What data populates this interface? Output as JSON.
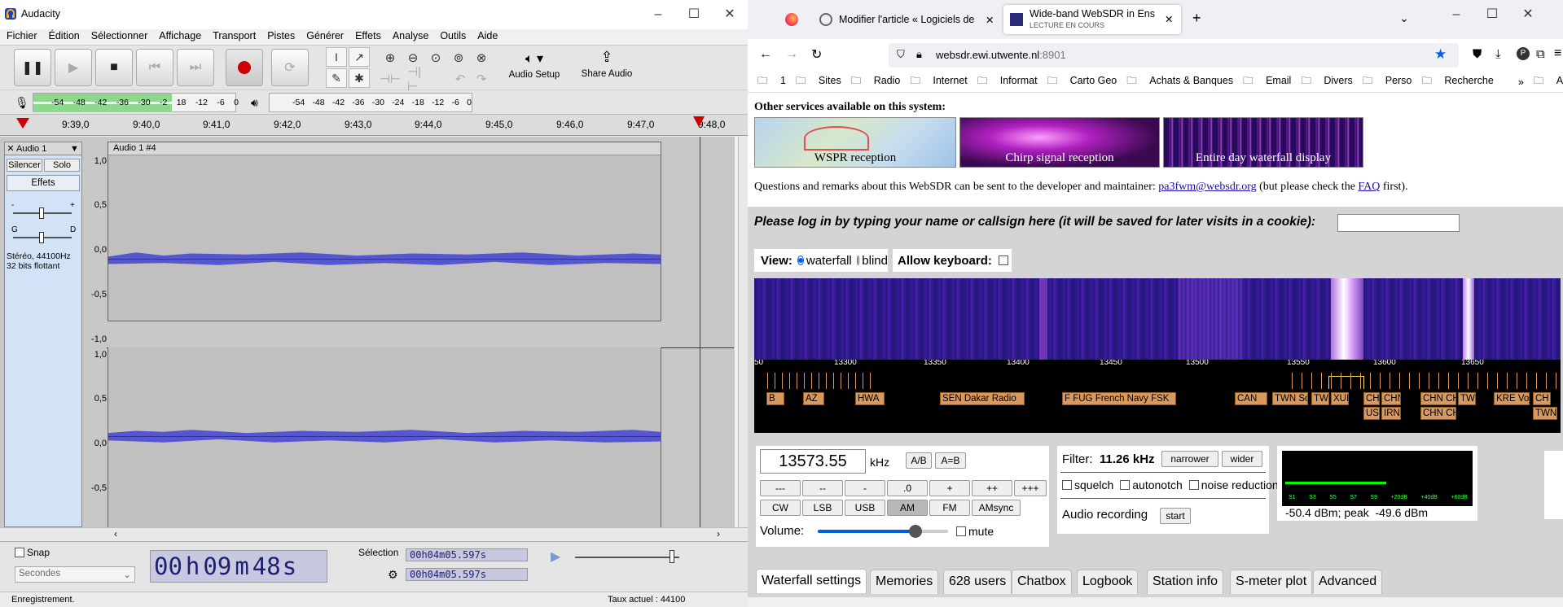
{
  "audacity": {
    "app_title": "Audacity",
    "menu": [
      "Fichier",
      "Édition",
      "Sélectionner",
      "Affichage",
      "Transport",
      "Pistes",
      "Générer",
      "Effets",
      "Analyse",
      "Outils",
      "Aide"
    ],
    "audio_setup_label": "Audio Setup",
    "share_audio_label": "Share Audio",
    "meter_scale": [
      "-54",
      "-48",
      "-42",
      "-36",
      "-30",
      "-24",
      "-18",
      "-12",
      "-6",
      "0"
    ],
    "meter_rec_scale": [
      "-54",
      "-48",
      "-42",
      "-36",
      "-30",
      "-2",
      "18",
      "-12",
      "-6",
      "0"
    ],
    "ruler_times": [
      "9:39,0",
      "9:40,0",
      "9:41,0",
      "9:42,0",
      "9:43,0",
      "9:44,0",
      "9:45,0",
      "9:46,0",
      "9:47,0",
      "9:48,0"
    ],
    "track": {
      "name": "Audio 1",
      "clip_name": "Audio 1 #4",
      "mute_label": "Silencer",
      "solo_label": "Solo",
      "effects_label": "Effets",
      "format_line1": "Stéréo, 44100Hz",
      "format_line2": "32 bits flottant",
      "gain_minus": "-",
      "gain_plus": "+",
      "pan_left": "G",
      "pan_right": "D"
    },
    "scale_top": [
      "1,0",
      "0,5",
      "0,0",
      "-0,5",
      "-1,0"
    ],
    "scale_bottom": [
      "1,0",
      "0,5",
      "0,0",
      "-0,5"
    ],
    "snap_label": "Snap",
    "snap_unit": "Secondes",
    "time_h": "00",
    "time_m": "09",
    "time_s": "48",
    "unit_h": "h",
    "unit_m": "m",
    "unit_s": "s",
    "selection_label": "Sélection",
    "selection_start": "00h04m05.597s",
    "selection_end": "00h04m05.597s",
    "status_left": "Enregistrement.",
    "status_rate": "Taux actuel : 44100"
  },
  "firefox": {
    "tabs": [
      {
        "label": "Modifier l'article « Logiciels de"
      },
      {
        "label": "Wide-band WebSDR in Enschede",
        "sublabel": "LECTURE EN COURS"
      }
    ],
    "url_host": "websdr.ewi.utwente.nl",
    "url_port": ":8901",
    "bookmarks": [
      "1",
      "Sites",
      "Radio",
      "Internet",
      "Informat",
      "Carto Geo",
      "Achats & Banques",
      "Email",
      "Divers",
      "Perso",
      "Recherche"
    ],
    "other_bookmarks": "Autres marque-pages"
  },
  "websdr": {
    "other_services": "Other services available on this system:",
    "services": [
      "WSPR reception",
      "Chirp signal reception",
      "Entire day waterfall display"
    ],
    "questions_pre": "Questions and remarks about this WebSDR can be sent to the developer and maintainer:",
    "email": "pa3fwm@websdr.org",
    "questions_mid": "(but please check the",
    "faq": "FAQ",
    "questions_post": "first).",
    "login_prompt": "Please log in by typing your name or callsign here (it will be saved for later visits in a cookie):",
    "view_label": "View:",
    "view_waterfall": "waterfall",
    "view_blind": "blind",
    "allow_keyboard": "Allow keyboard:",
    "freq_ticks": [
      "50",
      "13300",
      "13350",
      "13400",
      "13450",
      "13500",
      "13550",
      "13600",
      "13650"
    ],
    "station_labels": [
      "SEN Dakar Radio",
      "F FUG French Navy FSK",
      "CAN",
      "TWN So",
      "TWN",
      "XUI",
      "CH",
      "US",
      "IRN",
      "CHN",
      "CHN CH",
      "CHN CH",
      "TW",
      "KRE Vo",
      "CH",
      "TWN",
      "HWA",
      "AZ",
      "B"
    ],
    "frequency": "13573.55",
    "khz": "kHz",
    "ab": "A/B",
    "aeqb": "A=B",
    "step_buttons": [
      "---",
      "--",
      "-",
      ".0",
      "+",
      "++",
      "+++"
    ],
    "modes": [
      "CW",
      "LSB",
      "USB",
      "AM",
      "FM",
      "AMsync"
    ],
    "active_mode": "AM",
    "volume_label": "Volume:",
    "volume_level": 0.75,
    "mute_label": "mute",
    "filter_label": "Filter:",
    "filter_value": "11.26 kHz",
    "narrower": "narrower",
    "wider": "wider",
    "squelch": "squelch",
    "autonotch": "autonotch",
    "noise_reduction": "noise reduction",
    "audio_recording": "Audio recording",
    "start": "start",
    "smeter_ticks": [
      "S1",
      "S3",
      "S5",
      "S7",
      "S9",
      "+20dB",
      "+40dB",
      "+60dB"
    ],
    "smeter_reading": "-50.4 dBm; peak  -49.6 dBm",
    "smeter_level": 0.55,
    "bottom_tabs": [
      "Waterfall settings",
      "Memories",
      "628 users",
      "Chatbox",
      "Logbook",
      "Station info",
      "S-meter plot",
      "Advanced"
    ]
  }
}
